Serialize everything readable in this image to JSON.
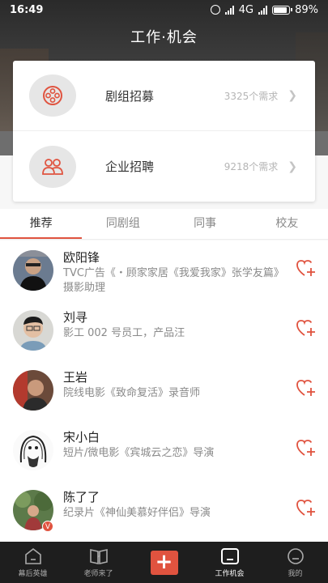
{
  "status_bar": {
    "time": "16:49",
    "network": "4G",
    "battery": "89%"
  },
  "header": {
    "title": "工作·机会"
  },
  "opportunities": [
    {
      "label": "剧组招募",
      "count": "3325个需求",
      "icon": "film-reel-icon"
    },
    {
      "label": "企业招聘",
      "count": "9218个需求",
      "icon": "people-icon"
    }
  ],
  "tabs": [
    "推荐",
    "同剧组",
    "同事",
    "校友"
  ],
  "active_tab": "推荐",
  "people": [
    {
      "name": "欧阳锋",
      "desc": "TVC广告《・顾家家居《我爱我家》张学友篇》摄影助理",
      "verified": false
    },
    {
      "name": "刘寻",
      "desc": "影工 002 号员工，产品汪",
      "verified": false
    },
    {
      "name": "王岩",
      "desc": "院线电影《致命复活》录音师",
      "verified": false
    },
    {
      "name": "宋小白",
      "desc": "短片/微电影《宾城云之恋》导演",
      "verified": false
    },
    {
      "name": "陈了了",
      "desc": "纪录片《神仙美慕好伴侣》导演",
      "verified": true,
      "badge": "V"
    }
  ],
  "bottom_nav": [
    {
      "label": "幕后英雄",
      "icon": "home-icon"
    },
    {
      "label": "老师来了",
      "icon": "book-icon"
    },
    {
      "label": "",
      "icon": "plus-icon"
    },
    {
      "label": "工作机会",
      "icon": "briefcase-icon"
    },
    {
      "label": "我的",
      "icon": "profile-icon"
    }
  ],
  "colors": {
    "accent": "#e0533f",
    "nav_bg": "#1e1e1e"
  }
}
